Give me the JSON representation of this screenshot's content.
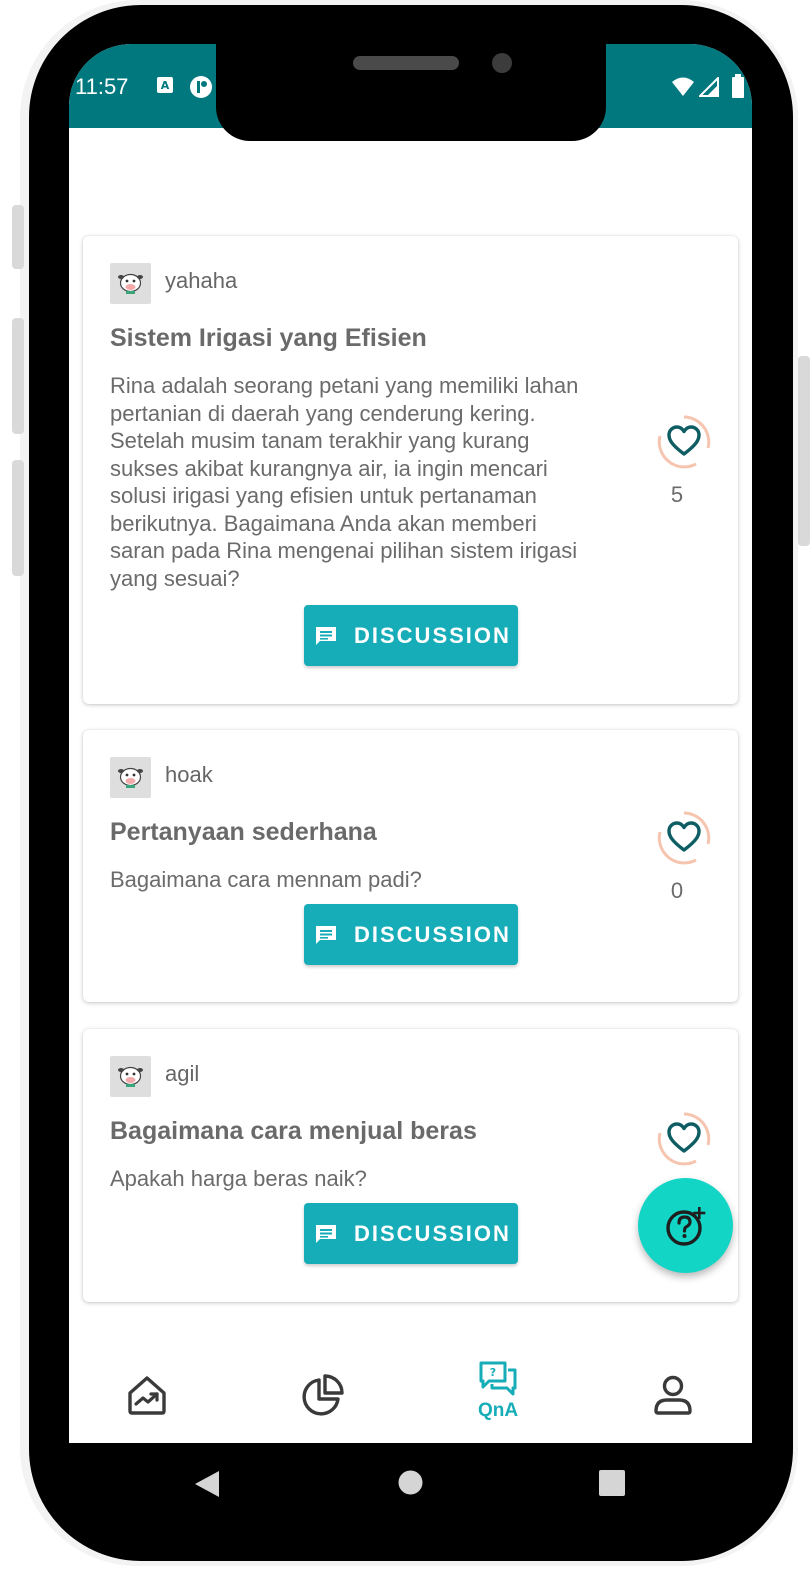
{
  "status_bar": {
    "time": "11:57"
  },
  "posts": [
    {
      "username": "yahaha",
      "title": "Sistem Irigasi yang Efisien",
      "body_lines": [
        "Rina adalah seorang petani yang memiliki lahan",
        "pertanian di daerah yang cenderung kering.",
        "Setelah musim tanam terakhir yang kurang",
        "sukses akibat kurangnya air, ia ingin mencari",
        "solusi irigasi yang efisien untuk pertanaman",
        "berikutnya. Bagaimana Anda akan memberi",
        "saran pada Rina mengenai pilihan sistem irigasi",
        "yang sesuai?"
      ],
      "likes": "5",
      "button_label": "DISCUSSION"
    },
    {
      "username": "hoak",
      "title": "Pertanyaan sederhana",
      "body_lines": [
        "Bagaimana cara mennam padi?"
      ],
      "likes": "0",
      "button_label": "DISCUSSION"
    },
    {
      "username": "agil",
      "title": "Bagaimana cara menjual beras",
      "body_lines": [
        "Apakah harga beras naik?"
      ],
      "likes": "",
      "button_label": "DISCUSSION"
    }
  ],
  "fab": {
    "icon": "ask-question-icon"
  },
  "bottom_nav": {
    "items": [
      {
        "icon": "home-chart-icon",
        "label": ""
      },
      {
        "icon": "pie-chart-icon",
        "label": ""
      },
      {
        "icon": "qna-chat-icon",
        "label": "QnA",
        "active": true
      },
      {
        "icon": "profile-icon",
        "label": ""
      }
    ]
  },
  "colors": {
    "status_bar": "#00787e",
    "accent": "#16adb8",
    "fab": "#13d5c6",
    "heart": "#0e5d63",
    "heart_ring": "#f6c5b0"
  }
}
